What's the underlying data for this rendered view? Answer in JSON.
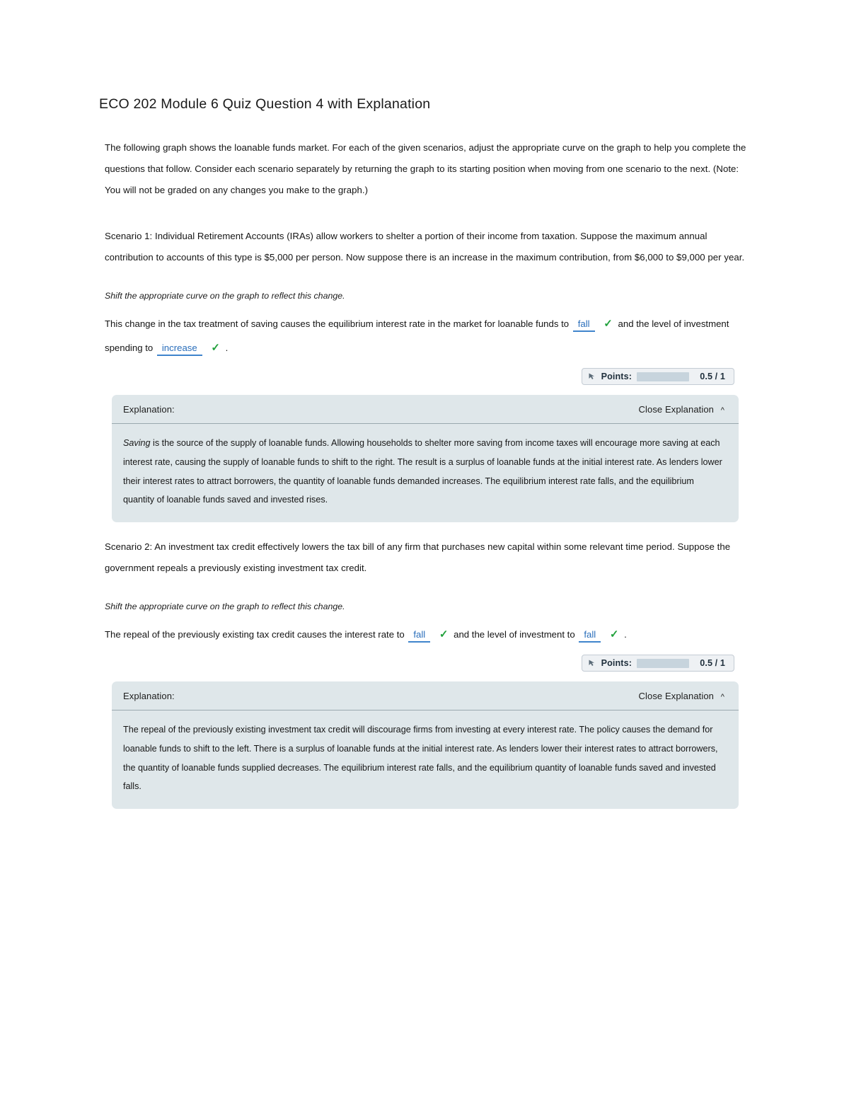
{
  "document": {
    "title": "ECO 202 Module 6 Quiz Question 4 with Explanation",
    "intro": "The following graph shows the loanable funds market. For each of the given scenarios, adjust the appropriate curve on the graph to help you complete the questions that follow. Consider each scenario separately by returning the graph to its starting position when moving from one scenario to the next. (Note: You will not be graded on any changes you make to the graph.)"
  },
  "scenario1": {
    "prompt": "Scenario 1: Individual Retirement Accounts (IRAs) allow workers to shelter a portion of their income from taxation. Suppose the maximum annual contribution to accounts of this type is $5,000 per person. Now suppose there is an increase in the maximum contribution, from $6,000 to $9,000 per year.",
    "instruction": "Shift the appropriate curve on the graph to reflect this change.",
    "question_part1": "This change in the tax treatment of saving causes the equilibrium interest rate in the market for loanable funds to",
    "answer1": "fall",
    "question_part2": "and the level of investment spending to",
    "answer2": "increase",
    "question_end": ".",
    "check_glyph": "✓",
    "points": {
      "label": "Points:",
      "value": "0.5 / 1",
      "fill_percent": 50
    },
    "explanation": {
      "title": "Explanation:",
      "toggle_label": "Close Explanation",
      "caret": "^",
      "lead_italic": "Saving",
      "text": " is the source of the supply of loanable funds. Allowing households to shelter more saving from income taxes will encourage more saving at each interest rate, causing the supply of loanable funds to shift to the right. The result is a surplus of loanable funds at the initial interest rate. As lenders lower their interest rates to attract borrowers, the quantity of loanable funds demanded increases. The equilibrium interest rate falls, and the equilibrium quantity of loanable funds saved and invested rises."
    }
  },
  "scenario2": {
    "prompt": "Scenario 2: An investment tax credit effectively lowers the tax bill of any firm that purchases new capital within some relevant time period. Suppose the government repeals a previously existing investment tax credit.",
    "instruction": "Shift the appropriate curve on the graph to reflect this change.",
    "question_part1": "The repeal of the previously existing tax credit causes the interest rate to",
    "answer1": "fall",
    "question_part2": "and the level of investment to",
    "answer2": "fall",
    "question_end": ".",
    "check_glyph": "✓",
    "points": {
      "label": "Points:",
      "value": "0.5 / 1",
      "fill_percent": 50
    },
    "explanation": {
      "title": "Explanation:",
      "toggle_label": "Close Explanation",
      "caret": "^",
      "lead_italic": "",
      "text": "The repeal of the previously existing investment tax credit will discourage firms from investing at every interest rate. The policy causes the demand for loanable funds to shift to the left. There is a surplus of loanable funds at the initial interest rate. As lenders lower their interest rates to attract borrowers, the quantity of loanable funds supplied decreases. The equilibrium interest rate falls, and the equilibrium quantity of loanable funds saved and invested falls."
    }
  },
  "colors": {
    "answer_blue": "#2a6ebb",
    "check_green": "#21a13c",
    "explanation_bg": "#dfe7ea",
    "points_fill": "#3d7fb9"
  }
}
